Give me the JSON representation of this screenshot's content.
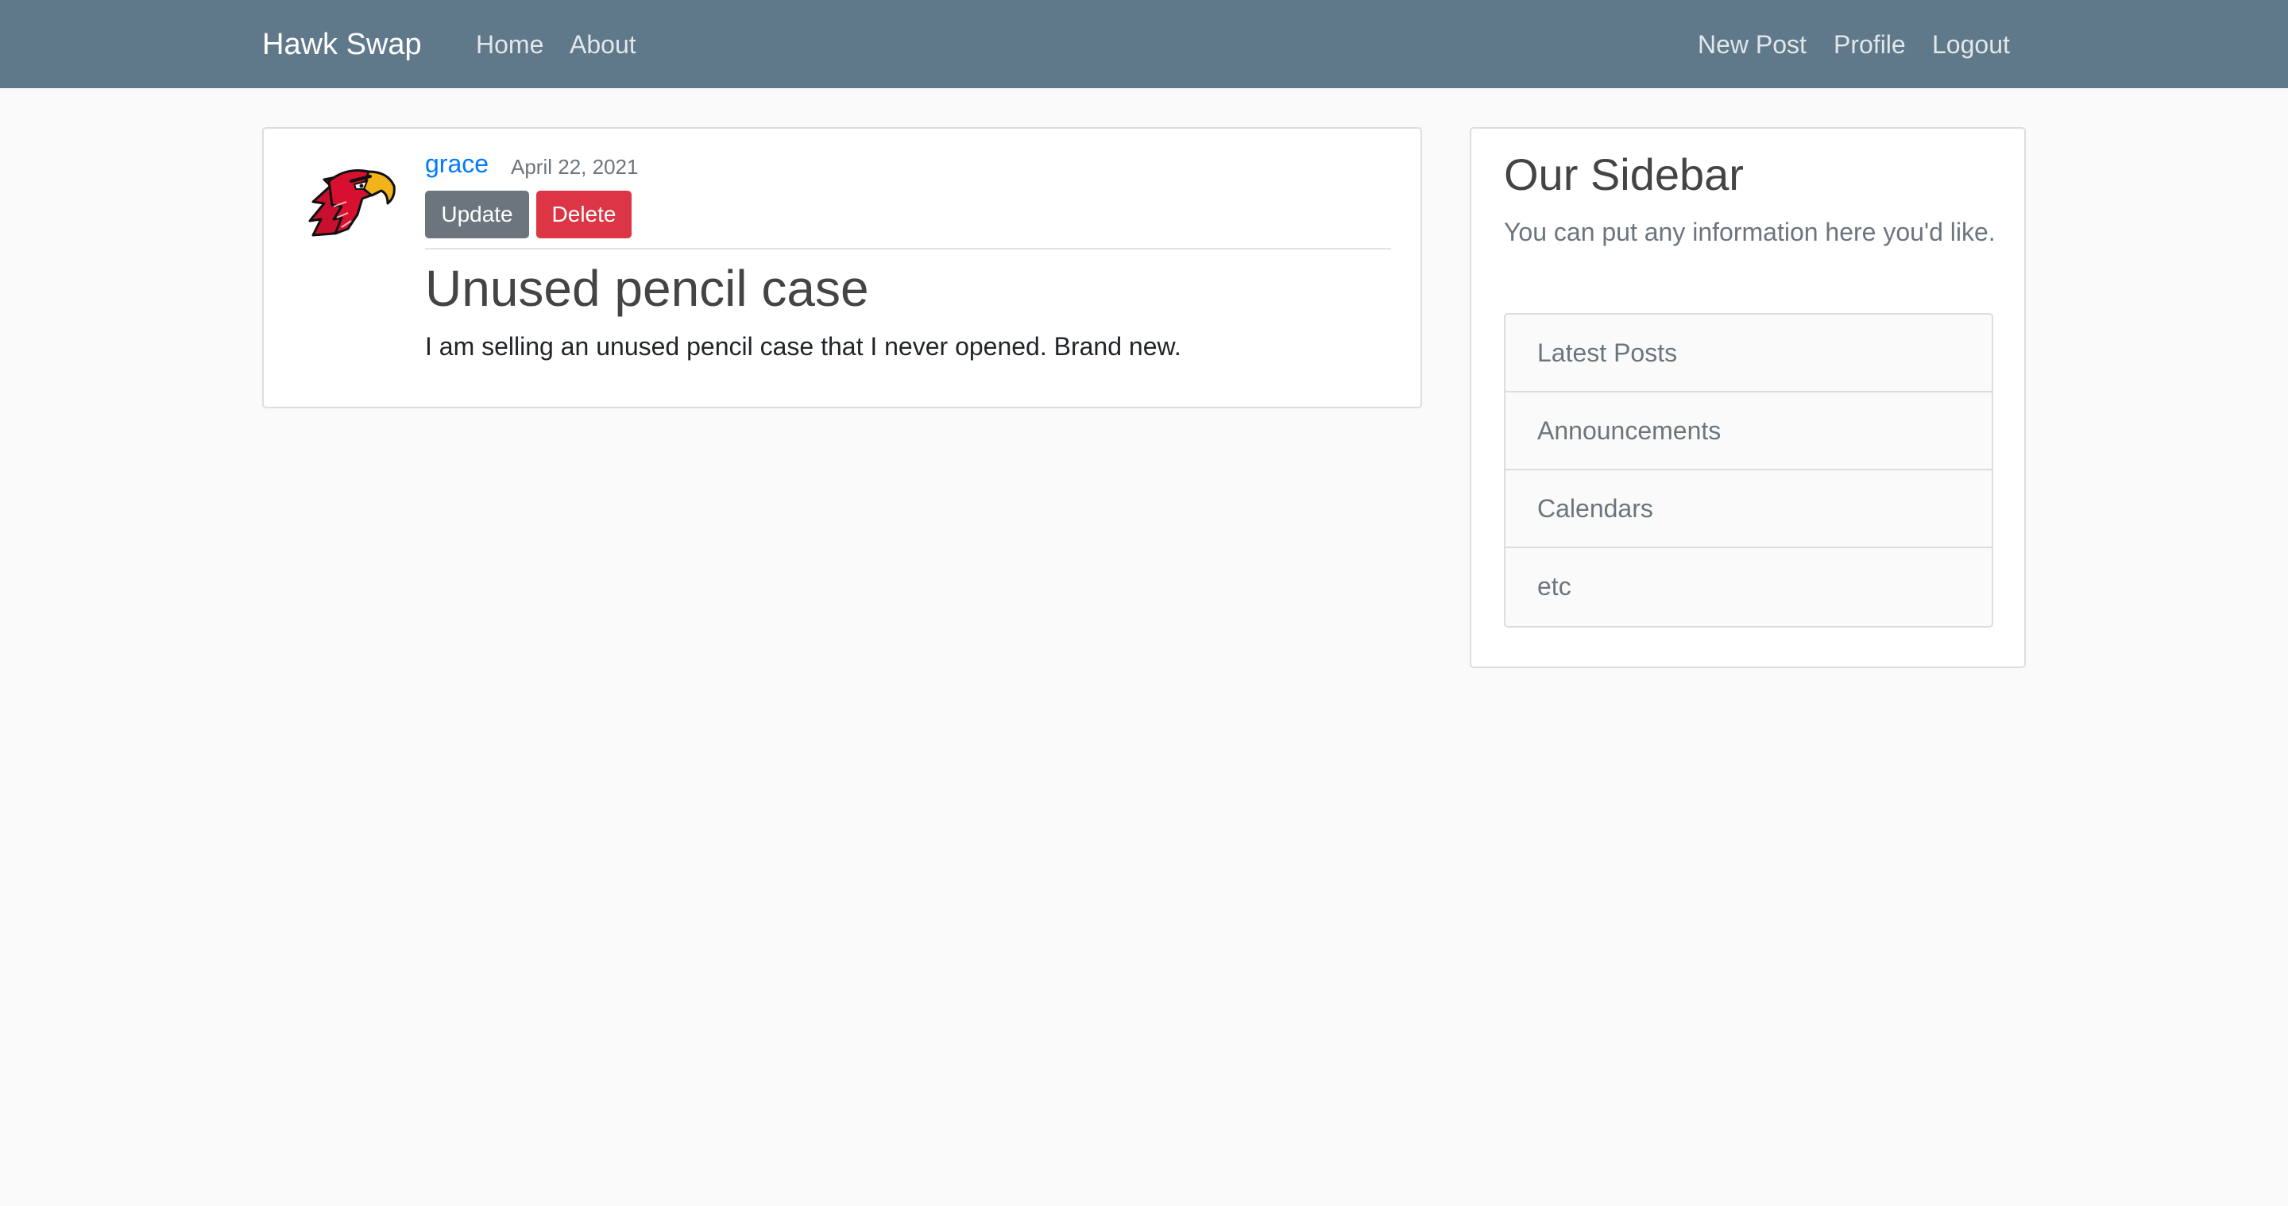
{
  "navbar": {
    "brand": "Hawk Swap",
    "left_links": [
      "Home",
      "About"
    ],
    "right_links": [
      "New Post",
      "Profile",
      "Logout"
    ]
  },
  "post": {
    "author": "grace",
    "date": "April 22, 2021",
    "update_label": "Update",
    "delete_label": "Delete",
    "title": "Unused pencil case",
    "content": "I am selling an unused pencil case that I never opened. Brand new."
  },
  "sidebar": {
    "title": "Our Sidebar",
    "text": "You can put any information here you'd like.",
    "items": [
      "Latest Posts",
      "Announcements",
      "Calendars",
      "etc"
    ]
  },
  "colors": {
    "navbar_bg": "#5f788a",
    "author_link": "#007bff",
    "update_button": "#6c757d",
    "delete_button": "#dc3545",
    "page_bg": "#fafafa"
  },
  "icons": {
    "avatar": "red-hawk-mascot-icon"
  }
}
